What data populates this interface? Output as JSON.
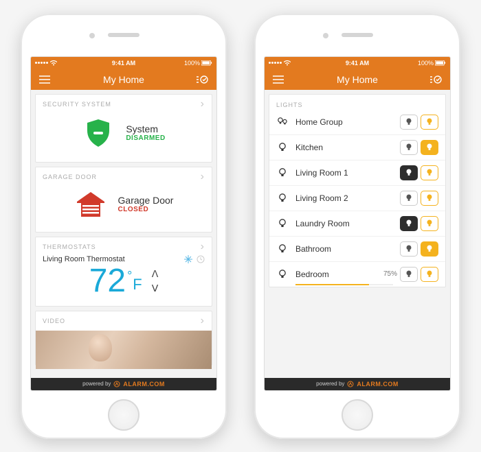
{
  "status": {
    "time": "9:41 AM",
    "battery": "100%"
  },
  "nav": {
    "title": "My Home"
  },
  "left": {
    "security": {
      "header": "SECURITY SYSTEM",
      "label": "System",
      "state": "DISARMED"
    },
    "garage": {
      "header": "GARAGE DOOR",
      "label": "Garage Door",
      "state": "CLOSED"
    },
    "therm": {
      "header": "THERMOSTATS",
      "device": "Living Room Thermostat",
      "temp": "72",
      "unit": "F"
    },
    "video": {
      "header": "VIDEO"
    }
  },
  "right": {
    "lights": {
      "header": "LIGHTS",
      "items": [
        {
          "label": "Home Group",
          "type": "group",
          "off_active": false,
          "on_active": false
        },
        {
          "label": "Kitchen",
          "type": "single",
          "off_active": false,
          "on_active": true
        },
        {
          "label": "Living Room 1",
          "type": "single",
          "off_active": true,
          "on_active": false
        },
        {
          "label": "Living Room 2",
          "type": "single",
          "off_active": false,
          "on_active": false
        },
        {
          "label": "Laundry Room",
          "type": "single",
          "off_active": true,
          "on_active": false
        },
        {
          "label": "Bathroom",
          "type": "single",
          "off_active": false,
          "on_active": true
        },
        {
          "label": "Bedroom",
          "type": "dimmer",
          "off_active": false,
          "on_active": false,
          "level": "75%"
        }
      ]
    }
  },
  "footer": {
    "powered": "powered by",
    "brand": "ALARM.COM"
  }
}
